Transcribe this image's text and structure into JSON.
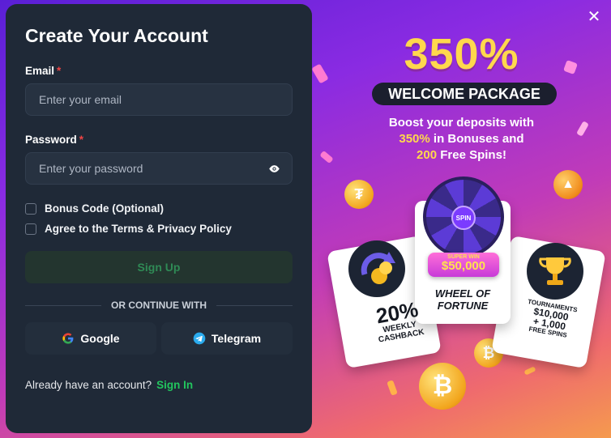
{
  "dialog": {
    "close_symbol": "✕"
  },
  "form": {
    "title": "Create Your Account",
    "email_label": "Email",
    "email_placeholder": "Enter your email",
    "password_label": "Password",
    "password_placeholder": "Enter your password",
    "required_mark": "*",
    "bonus_code_label": "Bonus Code (Optional)",
    "terms_label": "Agree to the Terms & Privacy Policy",
    "signup_label": "Sign Up",
    "divider_label": "OR CONTINUE WITH",
    "google_label": "Google",
    "telegram_label": "Telegram",
    "footer_text": "Already have an account?",
    "signin_label": "Sign In"
  },
  "promo": {
    "headline": "350%",
    "pill": "WELCOME PACKAGE",
    "sub_line1": "Boost your deposits with",
    "sub_pct": "350%",
    "sub_line2_rest": " in Bonuses and",
    "sub_spins": "200",
    "sub_line3_rest": " Free Spins!",
    "wheel_hub": "SPIN",
    "superwin_label": "SUPER WIN",
    "superwin_amount": "$50,000",
    "wheel_title_1": "WHEEL OF",
    "wheel_title_2": "FORTUNE",
    "cashback_pct": "20%",
    "cashback_1": "WEEKLY",
    "cashback_2": "CASHBACK",
    "tournaments_label": "TOURNAMENTS",
    "tour_amount": "$10,000",
    "tour_plus": "+ 1,000",
    "tour_spins": "FREE SPINS"
  },
  "colors": {
    "panel_bg": "#1f2937",
    "accent_green": "#22c55e",
    "promo_yellow": "#ffd84d",
    "required_red": "#ef4444"
  }
}
